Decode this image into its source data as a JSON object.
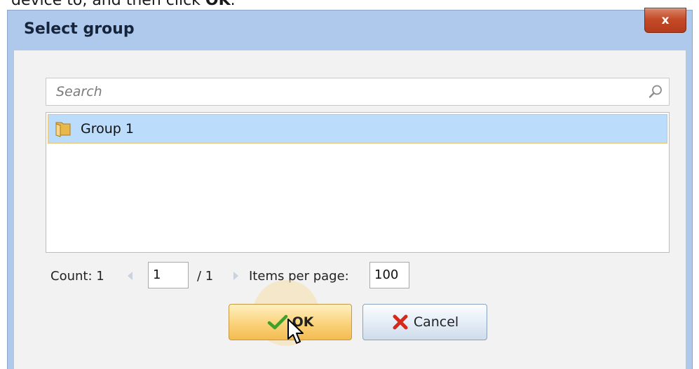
{
  "document": {
    "instruction_prefix": "device to, and then click ",
    "instruction_bold": "OK",
    "instruction_suffix": "."
  },
  "dialog": {
    "title": "Select group",
    "close_label": "x"
  },
  "search": {
    "placeholder": "Search",
    "value": ""
  },
  "list": {
    "items": [
      {
        "label": "Group 1",
        "icon": "folder-icon",
        "selected": true
      }
    ]
  },
  "pager": {
    "count_label": "Count: 1",
    "current_page": "1",
    "total_pages_label": "/ 1",
    "items_per_page_label": "Items per page:",
    "items_per_page": "100"
  },
  "buttons": {
    "ok_label": "OK",
    "cancel_label": "Cancel"
  },
  "colors": {
    "title_bar": "#aec9ec",
    "close_button": "#c44a27",
    "selection": "#bcdcfb",
    "ok_button": "#fad27a"
  }
}
